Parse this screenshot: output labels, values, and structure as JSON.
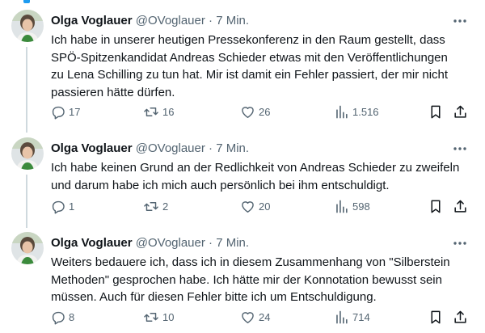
{
  "tweets": [
    {
      "name": "Olga Voglauer",
      "handle": "@OVoglauer",
      "separator": "·",
      "time": "7 Min.",
      "lines": [
        "Ich habe in unserer heutigen Pressekonferenz in den Raum gestellt, dass",
        "SPÖ-Spitzenkandidat Andreas Schieder etwas mit den Veröffentlichungen",
        "zu Lena Schilling zu tun hat. Mir ist damit ein Fehler passiert, der mir nicht",
        "passieren hätte dürfen."
      ],
      "replies": "17",
      "reposts": "16",
      "likes": "26",
      "views": "1.516"
    },
    {
      "name": "Olga Voglauer",
      "handle": "@OVoglauer",
      "separator": "·",
      "time": "7 Min.",
      "lines": [
        "Ich habe keinen Grund an der Redlichkeit von Andreas Schieder zu zweifeln",
        "und darum habe ich mich auch persönlich bei ihm entschuldigt."
      ],
      "replies": "1",
      "reposts": "2",
      "likes": "20",
      "views": "598"
    },
    {
      "name": "Olga Voglauer",
      "handle": "@OVoglauer",
      "separator": "·",
      "time": "7 Min.",
      "lines": [
        "Weiters bedauere ich, dass ich in diesem Zusammenhang von \"Silberstein",
        "Methoden\" gesprochen habe. Ich hätte mir der Konnotation bewusst sein",
        "müssen. Auch für diesen Fehler bitte ich um Entschuldigung."
      ],
      "replies": "8",
      "reposts": "10",
      "likes": "24",
      "views": "714"
    }
  ],
  "icons": {
    "more": "more-horizontal-icon",
    "reply": "reply-icon",
    "repost": "repost-icon",
    "like": "like-icon",
    "views": "views-icon",
    "bookmark": "bookmark-icon",
    "share": "share-icon"
  },
  "colors": {
    "text": "#0f1419",
    "secondary": "#536471",
    "accent": "#1d9bf0",
    "thread_line": "#cfd9de"
  }
}
